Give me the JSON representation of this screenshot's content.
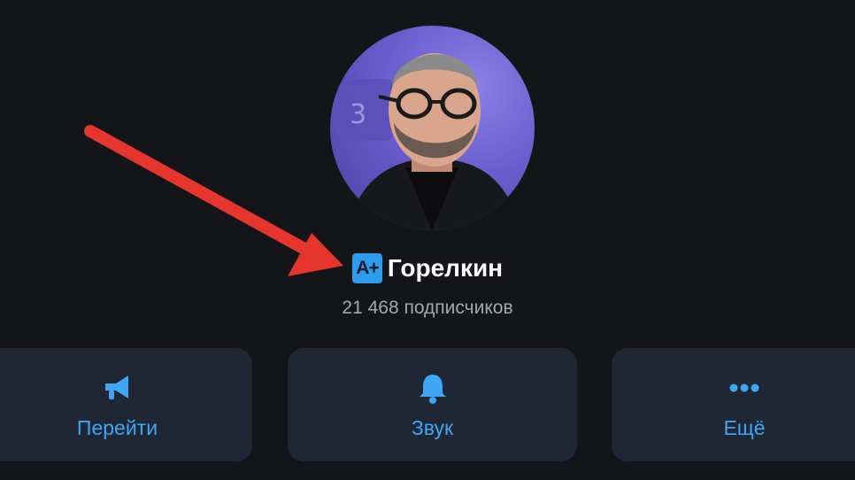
{
  "channel": {
    "name": "Горелкин",
    "badge_text": "A+",
    "subscribers": "21 468 подписчиков"
  },
  "actions": [
    {
      "label": "Перейти",
      "icon": "megaphone-icon"
    },
    {
      "label": "Звук",
      "icon": "bell-icon"
    },
    {
      "label": "Ещё",
      "icon": "more-dots-icon"
    }
  ],
  "colors": {
    "background": "#141518",
    "card": "#1e2733",
    "accent": "#3ea6f4",
    "badge": "#2d9cec",
    "arrow": "#e5352d",
    "avatar_bg": "#6a5ccc"
  }
}
